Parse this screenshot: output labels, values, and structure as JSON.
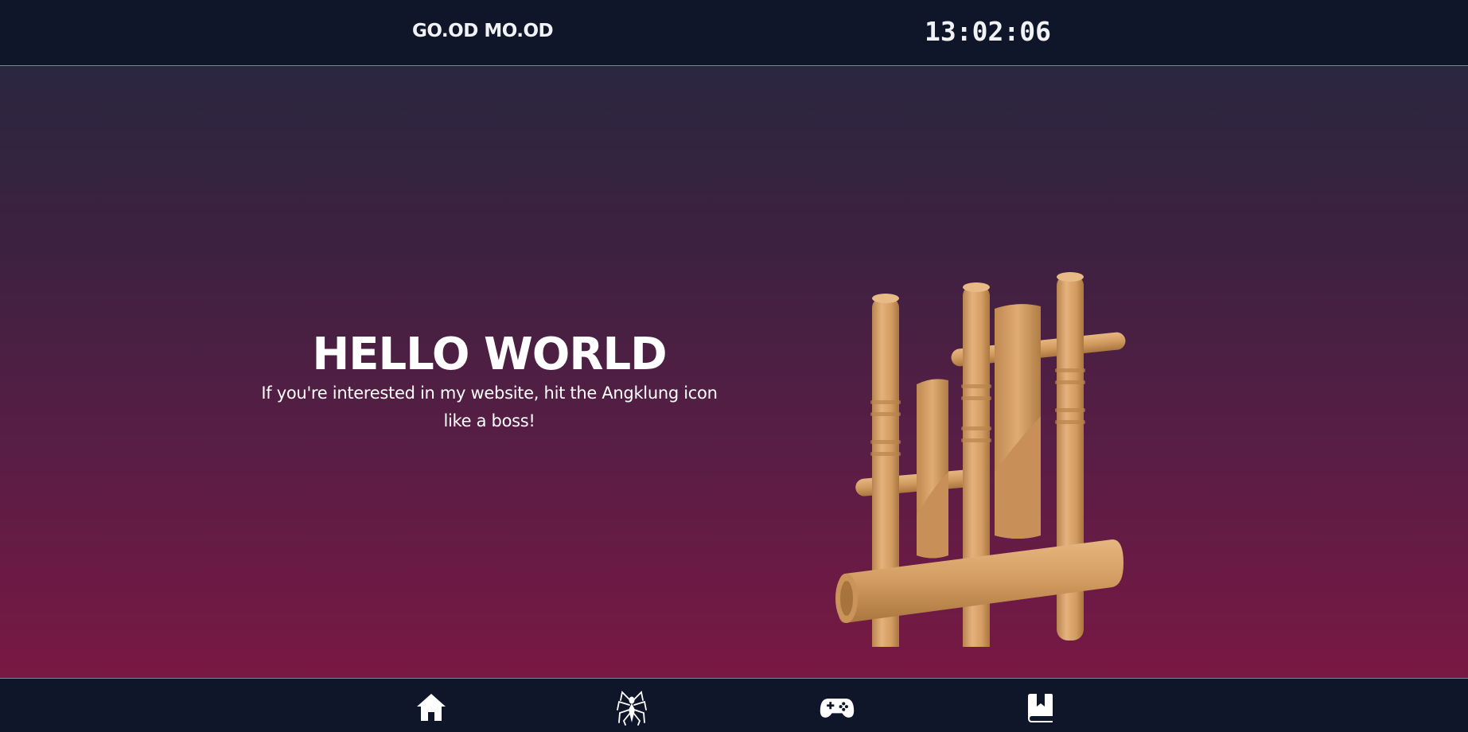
{
  "header": {
    "brand": "GO.OD MO.OD",
    "clock": "13:02:06"
  },
  "hero": {
    "title": "HELLO WORLD",
    "subtitle": "If you're interested in my website, hit the Angklung icon like a boss!",
    "image": "angklung-3d-model"
  },
  "nav": {
    "items": [
      {
        "icon": "home-icon"
      },
      {
        "icon": "spider-icon"
      },
      {
        "icon": "gamepad-icon"
      },
      {
        "icon": "bookmark-book-icon"
      }
    ]
  },
  "colors": {
    "bar_bg": "#0f1629",
    "gradient_top": "#2a2740",
    "gradient_bottom": "#781843",
    "angklung": "#d9a46c"
  }
}
